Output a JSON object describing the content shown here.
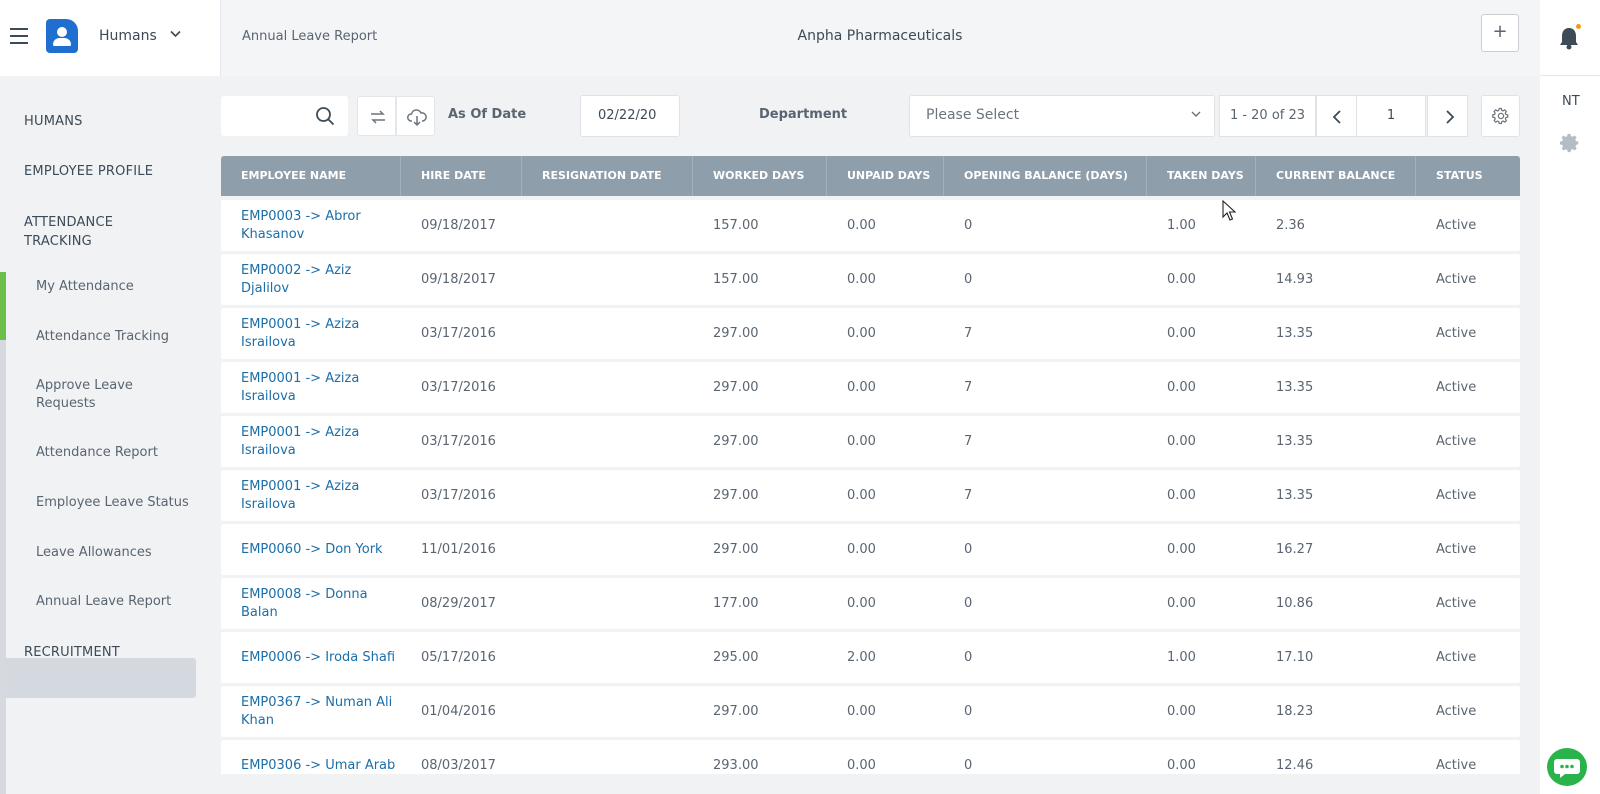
{
  "header": {
    "app_name": "Humans",
    "page_title": "Annual Leave Report",
    "company": "Anpha Pharmaceuticals",
    "add_label": "+"
  },
  "rail": {
    "user_initials": "NT"
  },
  "sidebar": {
    "sections": [
      "HUMANS",
      "EMPLOYEE PROFILE",
      "ATTENDANCE TRACKING",
      "RECRUITMENT"
    ],
    "sub_items": [
      "My Attendance",
      "Attendance Tracking",
      "Approve Leave Requests",
      "Attendance Report",
      "Employee Leave Status",
      "Leave Allowances",
      "Annual Leave Report"
    ],
    "active_sub_item": "Annual Leave Report"
  },
  "toolbar": {
    "search_value": "",
    "as_of_date_label": "As Of Date",
    "as_of_date_value": "02/22/20",
    "department_label": "Department",
    "department_placeholder": "Please Select",
    "pager_info": "1 - 20 of 23",
    "page_number": "1"
  },
  "table": {
    "columns": [
      "EMPLOYEE NAME",
      "HIRE DATE",
      "RESIGNATION DATE",
      "WORKED DAYS",
      "UNPAID DAYS",
      "OPENING BALANCE (DAYS)",
      "TAKEN DAYS",
      "CURRENT BALANCE",
      "STATUS"
    ],
    "rows": [
      {
        "employee": "EMP0003 -> Abror Khasanov",
        "hire_date": "09/18/2017",
        "resignation_date": "",
        "worked_days": "157.00",
        "unpaid_days": "0.00",
        "opening_balance": "0",
        "taken_days": "1.00",
        "current_balance": "2.36",
        "status": "Active"
      },
      {
        "employee": "EMP0002 -> Aziz Djalilov",
        "hire_date": "09/18/2017",
        "resignation_date": "",
        "worked_days": "157.00",
        "unpaid_days": "0.00",
        "opening_balance": "0",
        "taken_days": "0.00",
        "current_balance": "14.93",
        "status": "Active"
      },
      {
        "employee": "EMP0001 -> Aziza Israilova",
        "hire_date": "03/17/2016",
        "resignation_date": "",
        "worked_days": "297.00",
        "unpaid_days": "0.00",
        "opening_balance": "7",
        "taken_days": "0.00",
        "current_balance": "13.35",
        "status": "Active"
      },
      {
        "employee": "EMP0001 -> Aziza Israilova",
        "hire_date": "03/17/2016",
        "resignation_date": "",
        "worked_days": "297.00",
        "unpaid_days": "0.00",
        "opening_balance": "7",
        "taken_days": "0.00",
        "current_balance": "13.35",
        "status": "Active"
      },
      {
        "employee": "EMP0001 -> Aziza Israilova",
        "hire_date": "03/17/2016",
        "resignation_date": "",
        "worked_days": "297.00",
        "unpaid_days": "0.00",
        "opening_balance": "7",
        "taken_days": "0.00",
        "current_balance": "13.35",
        "status": "Active"
      },
      {
        "employee": "EMP0001 -> Aziza Israilova",
        "hire_date": "03/17/2016",
        "resignation_date": "",
        "worked_days": "297.00",
        "unpaid_days": "0.00",
        "opening_balance": "7",
        "taken_days": "0.00",
        "current_balance": "13.35",
        "status": "Active"
      },
      {
        "employee": "EMP0060 -> Don York",
        "hire_date": "11/01/2016",
        "resignation_date": "",
        "worked_days": "297.00",
        "unpaid_days": "0.00",
        "opening_balance": "0",
        "taken_days": "0.00",
        "current_balance": "16.27",
        "status": "Active"
      },
      {
        "employee": "EMP0008 -> Donna Balan",
        "hire_date": "08/29/2017",
        "resignation_date": "",
        "worked_days": "177.00",
        "unpaid_days": "0.00",
        "opening_balance": "0",
        "taken_days": "0.00",
        "current_balance": "10.86",
        "status": "Active"
      },
      {
        "employee": "EMP0006 -> Iroda Shafi",
        "hire_date": "05/17/2016",
        "resignation_date": "",
        "worked_days": "295.00",
        "unpaid_days": "2.00",
        "opening_balance": "0",
        "taken_days": "1.00",
        "current_balance": "17.10",
        "status": "Active"
      },
      {
        "employee": "EMP0367 -> Numan Ali Khan",
        "hire_date": "01/04/2016",
        "resignation_date": "",
        "worked_days": "297.00",
        "unpaid_days": "0.00",
        "opening_balance": "0",
        "taken_days": "0.00",
        "current_balance": "18.23",
        "status": "Active"
      },
      {
        "employee": "EMP0306 -> Umar Arab",
        "hire_date": "08/03/2017",
        "resignation_date": "",
        "worked_days": "293.00",
        "unpaid_days": "0.00",
        "opening_balance": "0",
        "taken_days": "0.00",
        "current_balance": "12.46",
        "status": "Active"
      }
    ]
  },
  "colors": {
    "accent_green": "#6cc04a",
    "link_blue": "#1b6ea8",
    "header_grey": "#8e9eab",
    "brand_blue": "#1f6fd0",
    "chat_green": "#2bb34b",
    "notification_orange": "#f39c12"
  },
  "icons": [
    "menu-icon",
    "app-logo-icon",
    "chevron-down-icon",
    "plus-icon",
    "bell-icon",
    "gear-icon",
    "search-icon",
    "refresh-icon",
    "cloud-download-icon",
    "chevron-left-icon",
    "chevron-right-icon",
    "chat-icon",
    "mouse-cursor-icon"
  ]
}
